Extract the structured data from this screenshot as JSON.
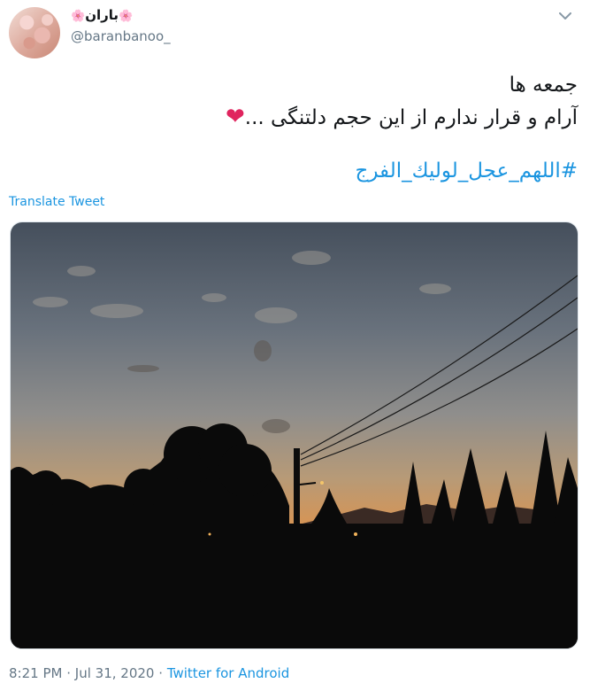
{
  "author": {
    "display_name": "باران",
    "flower_glyph": "🌸",
    "handle": "@baranbanoo_"
  },
  "tweet": {
    "lines": [
      "جمعه ها",
      "آرام و قرار ندارم از این حجم دلتنگی ..."
    ],
    "heart_glyph": "❤",
    "hashtag": "#اللهم_عجل_لوليك_الفرج",
    "translate_label": "Translate Tweet"
  },
  "meta": {
    "time": "8:21 PM",
    "date": "Jul 31, 2020",
    "separator": "·",
    "source": "Twitter for Android"
  },
  "icons": {
    "menu": "chevron-down-icon"
  },
  "colors": {
    "link": "#1b95e0",
    "muted": "#657786",
    "heart": "#e0245e"
  }
}
